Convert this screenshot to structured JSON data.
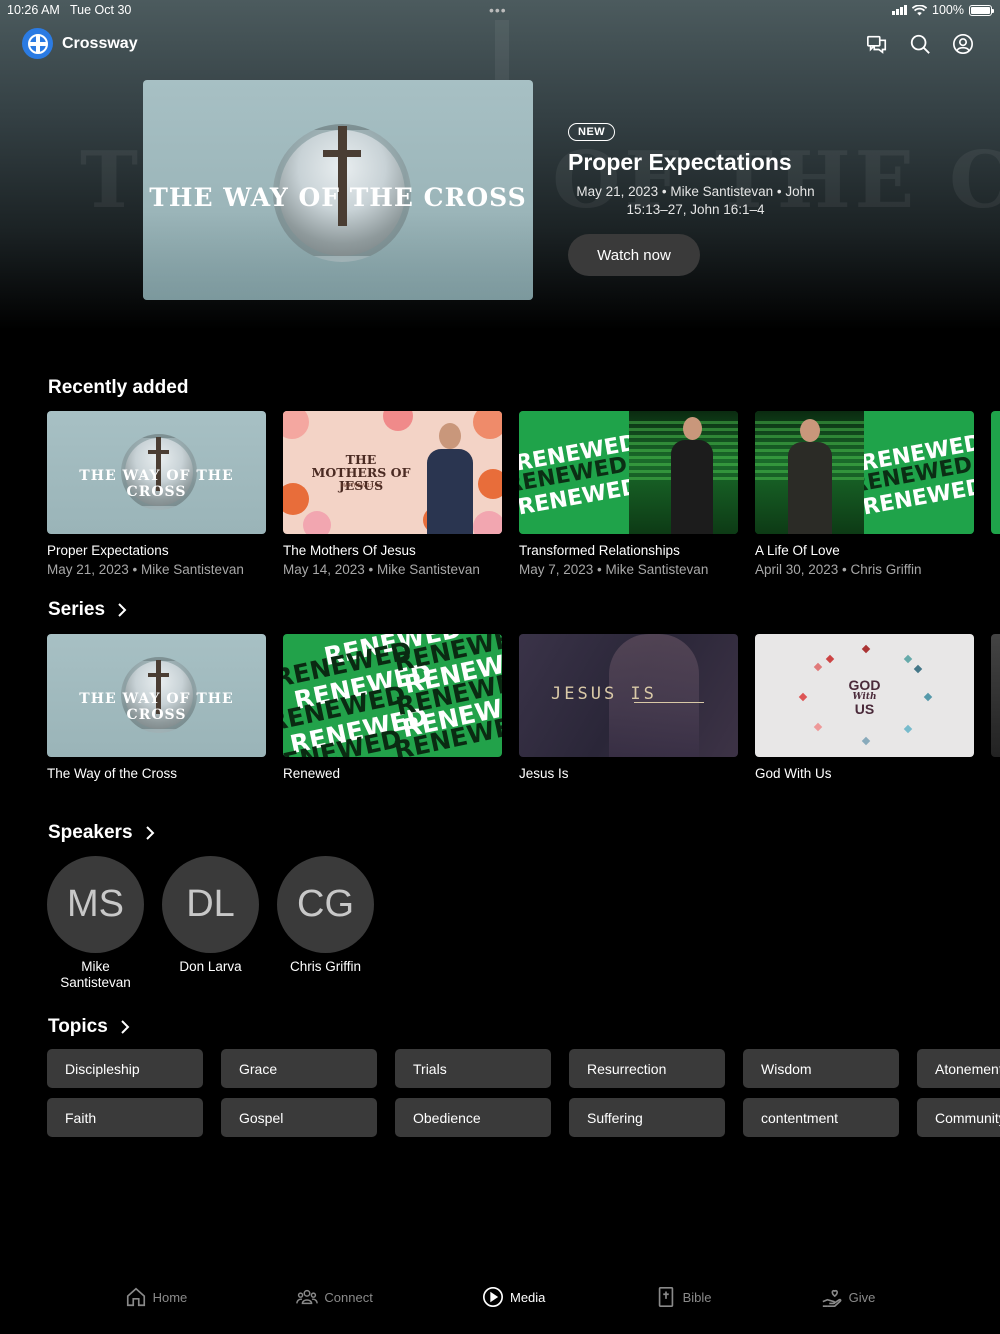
{
  "status_bar": {
    "time": "10:26 AM",
    "date": "Tue Oct 30",
    "battery": "100%"
  },
  "app": {
    "name": "Crossway"
  },
  "header_icons": [
    "chat-icon",
    "search-icon",
    "account-icon"
  ],
  "hero": {
    "badge": "NEW",
    "title": "Proper Expectations",
    "meta": "May 21, 2023 • Mike Santistevan • John 15:13–27, John 16:1–4",
    "button": "Watch now",
    "art_title": "THE WAY OF THE CROSS",
    "ghost_text": "THE WAY OF THE CROSS"
  },
  "recently_added": {
    "title": "Recently added",
    "items": [
      {
        "title": "Proper Expectations",
        "sub": "May 21, 2023 • Mike Santistevan",
        "art": "THE WAY OF THE CROSS"
      },
      {
        "title": "The Mothers Of Jesus",
        "sub": "May 14, 2023 • Mike Santistevan",
        "art": "THE MOTHERS OF JESUS",
        "art_sub": "MATTHEW 1:1-17"
      },
      {
        "title": "Transformed Relationships",
        "sub": "May 7, 2023 • Mike Santistevan",
        "art": "RENEWED"
      },
      {
        "title": "A Life Of Love",
        "sub": "April 30, 2023 • Chris Griffin",
        "art": "RENEWED"
      }
    ]
  },
  "series": {
    "title": "Series",
    "items": [
      {
        "title": "The Way of the Cross",
        "art": "THE WAY OF THE CROSS"
      },
      {
        "title": "Renewed",
        "art": "RENEWED"
      },
      {
        "title": "Jesus Is",
        "art": "JESUS IS"
      },
      {
        "title": "God With Us",
        "art_top": "GOD",
        "art_mid": "With",
        "art_bot": "US"
      }
    ]
  },
  "speakers": {
    "title": "Speakers",
    "items": [
      {
        "initials": "MS",
        "name": "Mike Santistevan"
      },
      {
        "initials": "DL",
        "name": "Don Larva"
      },
      {
        "initials": "CG",
        "name": "Chris Griffin"
      }
    ]
  },
  "topics": {
    "title": "Topics",
    "row1": [
      "Discipleship",
      "Grace",
      "Trials",
      "Resurrection",
      "Wisdom",
      "Atonement"
    ],
    "row2": [
      "Faith",
      "Gospel",
      "Obedience",
      "Suffering",
      "contentment",
      "Community"
    ]
  },
  "tabbar": {
    "items": [
      {
        "label": "Home",
        "icon": "home-icon"
      },
      {
        "label": "Connect",
        "icon": "people-icon"
      },
      {
        "label": "Media",
        "icon": "play-circle-icon",
        "active": true
      },
      {
        "label": "Bible",
        "icon": "bible-icon"
      },
      {
        "label": "Give",
        "icon": "give-icon"
      }
    ]
  },
  "colors": {
    "accent": "#2b7be3",
    "chip_bg": "#3a3a3a",
    "green": "#22a24a"
  }
}
